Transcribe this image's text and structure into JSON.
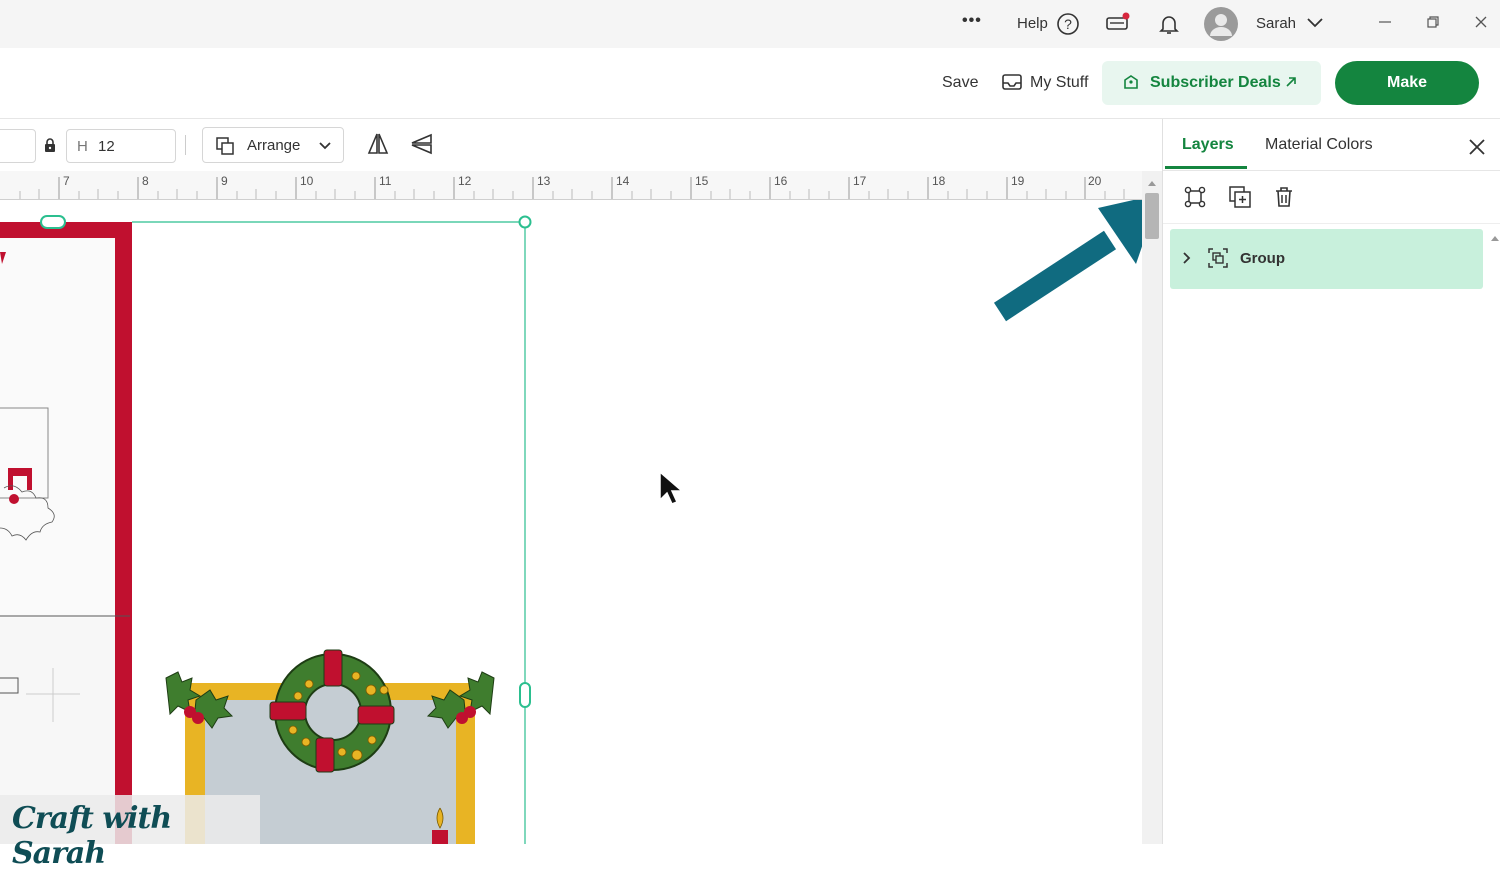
{
  "topbar": {
    "more_label": "•••",
    "help_label": "Help",
    "user_name": "Sarah"
  },
  "header": {
    "save_label": "Save",
    "mystuff_label": "My Stuff",
    "deals_label": "Subscriber Deals",
    "make_label": "Make"
  },
  "toolbar": {
    "height_prefix": "H",
    "height_value": "12",
    "arrange_label": "Arrange"
  },
  "ruler": {
    "labels": [
      "7",
      "8",
      "9",
      "10",
      "11",
      "12",
      "13",
      "14",
      "15",
      "16",
      "17",
      "18",
      "19",
      "20"
    ]
  },
  "panel": {
    "tabs": [
      {
        "label": "Layers",
        "active": true
      },
      {
        "label": "Material Colors",
        "active": false
      }
    ],
    "layers": [
      {
        "label": "Group",
        "selected": true
      }
    ]
  },
  "watermark": {
    "text": "Craft with Sarah"
  },
  "colors": {
    "accent_green": "#14853f",
    "selection_teal": "#2bbf8f",
    "layer_selected": "#c8f0dc",
    "annotation_arrow": "#106b80",
    "card_red": "#c0102f"
  }
}
